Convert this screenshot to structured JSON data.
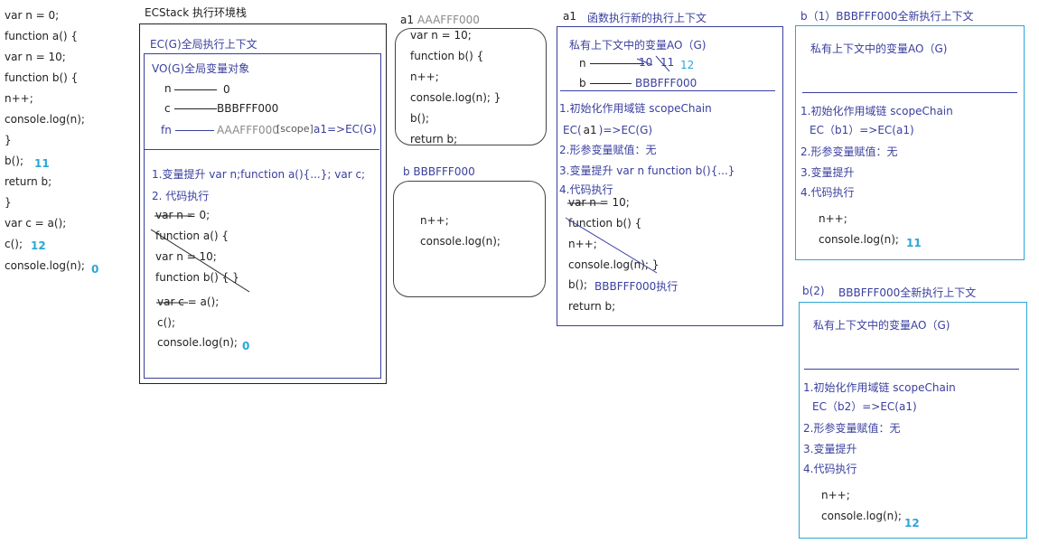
{
  "left_code": {
    "lines": [
      "var n = 0;",
      "function a() {",
      "var n = 10;",
      "function b() {",
      "n++;",
      "console.log(n);",
      "}",
      "b();",
      "return b;",
      "}",
      "var c = a();",
      "c();",
      "console.log(n);"
    ],
    "notes": {
      "b_call": "11",
      "c_call": "12",
      "final_log": "0"
    }
  },
  "ecstack": {
    "title": "ECStack 执行环境栈",
    "global_ec_title": "EC(G)全局执行上下文",
    "vo_title": "VO(G)全局变量对象",
    "vars": [
      {
        "name": "n",
        "value": "0"
      },
      {
        "name": "c",
        "value": "BBBFFF000"
      },
      {
        "name": "fn",
        "value": "AAAFFF000"
      }
    ],
    "scope_label": "[scope]",
    "scope_value": "a1=>EC(G)",
    "step1": "1.变量提升  var n;function a(){...}; var c;",
    "step2": "2. 代码执行",
    "exec_lines": [
      "var n = 0;",
      "function a() {",
      "var n = 10;",
      "function b() {   }",
      "var c = a();",
      "c();",
      "console.log(n);"
    ],
    "final_output": "0"
  },
  "heap_a1": {
    "label": "a1",
    "addr": "AAAFFF000",
    "lines": [
      "var n = 10;",
      "function b() {",
      "n++;",
      "console.log(n);   }",
      "b();",
      "return b;"
    ]
  },
  "heap_b": {
    "label": "b BBBFFF000",
    "lines": [
      "n++;",
      "console.log(n);"
    ]
  },
  "ctx_a1": {
    "label": "a1",
    "title": "函数执行新的执行上下文",
    "ao_title": "私有上下文中的变量AO（G)",
    "n_old": "10",
    "n_new1": "11",
    "n_new2": "12",
    "b_name": "b",
    "b_value": "BBBFFF000",
    "step1": "1.初始化作用域链 scopeChain",
    "scope_chain_prefix": "EC(",
    "scope_chain_a1": "a1",
    "scope_chain_suffix": ")=>EC(G)",
    "step2": "2.形参变量赋值：无",
    "step3": "3.变量提升  var n function b(){...}",
    "step4": "4.代码执行",
    "exec_lines": [
      "var n = 10;",
      "function b() {",
      "n++;",
      "console.log(n);   }",
      "b();",
      "return b;"
    ],
    "b_exec_note": "BBBFFF000执行"
  },
  "ctx_b1": {
    "title": "b（1）BBBFFF000全新执行上下文",
    "ao_title": "私有上下文中的变量AO（G)",
    "step1": "1.初始化作用域链 scopeChain",
    "scope_chain": "EC（b1）=>EC(a1)",
    "step2": "2.形参变量赋值：无",
    "step3": "3.变量提升",
    "step4": "4.代码执行",
    "exec_lines": [
      "n++;",
      "console.log(n);"
    ],
    "output": "11"
  },
  "ctx_b2": {
    "title_prefix": "b(2)",
    "title": "BBBFFF000全新执行上下文",
    "ao_title": "私有上下文中的变量AO（G)",
    "step1": "1.初始化作用域链 scopeChain",
    "scope_chain": "EC（b2）=>EC(a1)",
    "step2": "2.形参变量赋值：无",
    "step3": "3.变量提升",
    "step4": "4.代码执行",
    "exec_lines": [
      "n++;",
      "console.log(n);"
    ],
    "output": "12"
  },
  "colors": {
    "border": "#222222",
    "panel_border": "#3a3f9e",
    "cyan_border": "#2aa7d6",
    "text_blue": "#3a3f9e",
    "text_gray": "#8a8a8a",
    "accent_cyan": "#2aa7d6"
  }
}
